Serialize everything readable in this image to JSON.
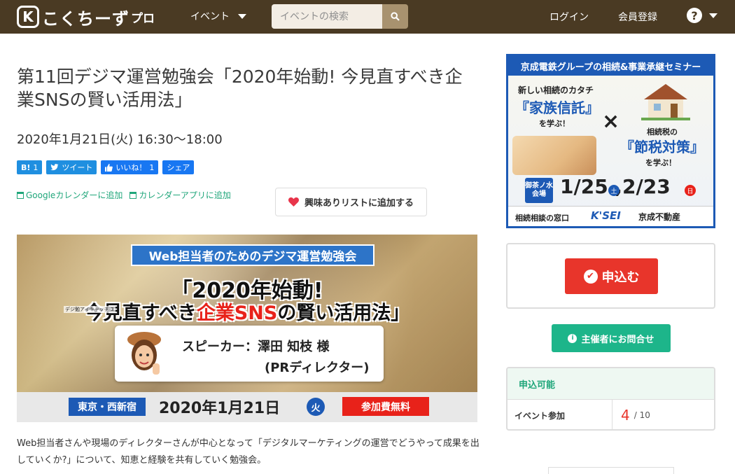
{
  "header": {
    "logo_mark": "K",
    "logo_text": "こくちーず",
    "logo_pro": "プロ",
    "nav_event": "イベント",
    "search_placeholder": "イベントの検索",
    "login": "ログイン",
    "register": "会員登録",
    "help": "?"
  },
  "event": {
    "title": "第11回デジマ運営勉強会「2020年始動! 今見直すべき企業SNSの賢い活用法」",
    "datetime": "2020年1月21日(火) 16:30〜18:00"
  },
  "share": {
    "hatena_label": "B!",
    "hatena_count": "1",
    "tweet_label": "ツイート",
    "like_label": "いいね！",
    "like_count": "1",
    "share_label": "シェア"
  },
  "calendar": {
    "google": "Googleカレンダーに追加",
    "app": "カレンダーアプリに追加"
  },
  "interest_button": "興味ありリストに追加する",
  "banner": {
    "tag": "Web担当者のためのデジマ運営勉強会",
    "line1": "「2020年始動!",
    "line2_pre": "今見直すべき",
    "line2_red": "企業SNS",
    "line2_post": "の賢い活用法」",
    "catch": "デジ勉アイキャッチ-3",
    "speaker": "スピーカー：澤田 知枝 様",
    "role": "(PRディレクター)",
    "location": "東京・西新宿",
    "date": "2020年1月21日",
    "dow": "火",
    "free": "参加費無料"
  },
  "description": "Web担当者さんや現場のディレクターさんが中心となって「デジタルマーケティングの運営でどうやって成果を出していくか?」について、知恵と経験を共有していく勉強会。",
  "ad": {
    "header": "京成電鉄グループの相続&事業承継セミナー",
    "left_l1": "新しい相続のカタチ",
    "left_l2": "『家族信託』",
    "left_l3": "を学ぶ！",
    "cross": "×",
    "right_l1": "相続税の",
    "right_l2": "『節税対策』",
    "right_l3": "を学ぶ！",
    "venue": "御茶ノ水会場",
    "dates": "1/25 ,2/23",
    "sat": "土",
    "mon": "日",
    "foot_left": "相続相談の窓口",
    "foot_logo": "K'SEI",
    "foot_right": "京成不動産"
  },
  "sidebar": {
    "apply": "申込む",
    "contact": "主催者にお問合せ",
    "status_head": "申込可能",
    "status_label": "イベント参加",
    "status_current": "4",
    "status_max": "/ 10"
  },
  "colors": {
    "header_bg": "#4a3a23",
    "accent_green": "#1fa67a",
    "apply_red": "#e8352b",
    "banner_blue": "#1d5ab5"
  }
}
